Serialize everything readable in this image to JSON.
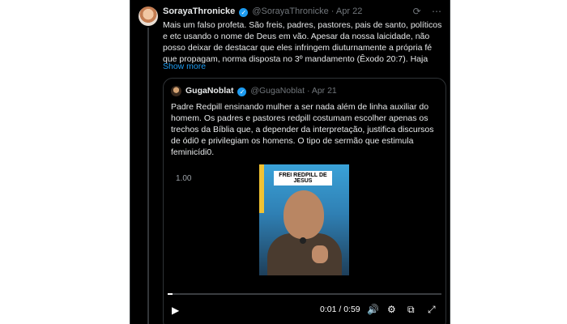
{
  "tweet": {
    "author_name": "SorayaThronicke",
    "handle": "@SorayaThronicke",
    "date": "Apr 22",
    "text": "Mais um falso profeta. São freis, padres, pastores, pais de santo, políticos e etc usando o nome de Deus em vão. Apesar da nossa laicidade, não posso deixar de destacar que eles infringem diuturnamente a própria fé que propagam, norma disposta no  3º mandamento (Êxodo 20:7). Haja",
    "show_more": "Show more"
  },
  "quote": {
    "author_name": "GugaNoblat",
    "handle": "@GugaNoblat",
    "date": "Apr 21",
    "text": "Padre Redpill ensinando mulher a ser nada além de linha auxiliar do homem. Os padres e pastores redpill costumam escolher apenas os trechos da Bíblia que, a depender da interpretação, justifica discursos de ódi0 e privilegiam os homens. O tipo de sermão que estimula feminicídi0."
  },
  "video": {
    "caption": "FREI REDPILL DE JESUS",
    "playback_rate": "1.00",
    "time": "0:01 / 0:59",
    "progress_fraction": 0.017
  },
  "icons": {
    "verified": "verified-badge-icon",
    "grok": "grok-icon",
    "more": "more-icon",
    "play": "play-icon",
    "volume": "volume-icon",
    "settings": "settings-icon",
    "popout": "popout-icon",
    "fullscreen": "fullscreen-icon"
  },
  "colors": {
    "accent": "#1d9bf0",
    "background": "#000000",
    "text": "#e7e9ea",
    "muted": "#71767b"
  }
}
